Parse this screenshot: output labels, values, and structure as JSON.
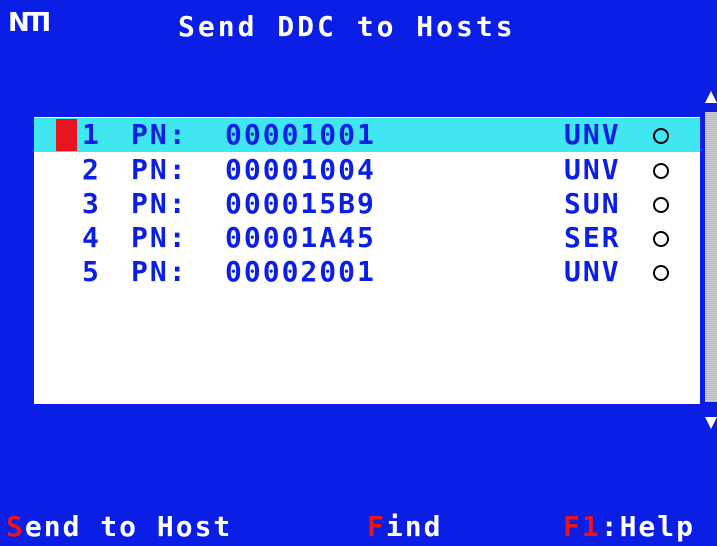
{
  "header": {
    "logo": "NTI",
    "title": "Send DDC to Hosts"
  },
  "list": {
    "rows": [
      {
        "num": "1",
        "pn_label": "PN:",
        "pn": "00001001",
        "type": "UNV",
        "selected": true
      },
      {
        "num": "2",
        "pn_label": "PN:",
        "pn": "00001004",
        "type": "UNV",
        "selected": false
      },
      {
        "num": "3",
        "pn_label": "PN:",
        "pn": "000015B9",
        "type": "SUN",
        "selected": false
      },
      {
        "num": "4",
        "pn_label": "PN:",
        "pn": "00001A45",
        "type": "SER",
        "selected": false
      },
      {
        "num": "5",
        "pn_label": "PN:",
        "pn": "00002001",
        "type": "UNV",
        "selected": false
      }
    ]
  },
  "footer": {
    "send_hotkey": "S",
    "send_rest": "end to Host",
    "find_hotkey": "F",
    "find_rest": "ind",
    "help_hotkey": "F1",
    "help_rest": ":Help"
  },
  "colors": {
    "background": "#0a1ee6",
    "selection": "#40e6f0",
    "cursor": "#e8141e",
    "hotkey": "#e8141e"
  }
}
